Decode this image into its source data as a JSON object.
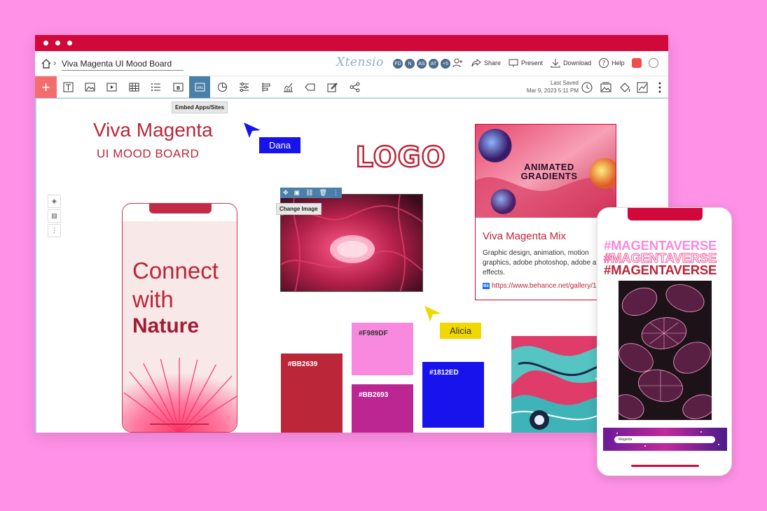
{
  "window": {
    "title_dots": 3
  },
  "topbar": {
    "board_name": "Viva Magenta UI Mood Board",
    "app_logo": "Xtensio",
    "avatars": [
      "FD",
      "N",
      "AS",
      "AT",
      "+5"
    ],
    "actions": {
      "share": "Share",
      "present": "Present",
      "download": "Download",
      "help": "Help"
    }
  },
  "toolbar": {
    "tools": [
      "text",
      "image",
      "video",
      "table",
      "list",
      "button",
      "url",
      "chart",
      "settings",
      "align",
      "graph",
      "tag",
      "edit",
      "share"
    ],
    "active_tool": "url",
    "url_label": "URL",
    "button_label": "B",
    "tooltip": "Embed Apps/Sites",
    "last_saved_label": "Last Saved",
    "last_saved_date": "Mar 9, 2023 5:11 PM"
  },
  "board": {
    "title": "Viva Magenta",
    "subtitle": "UI MOOD BOARD",
    "logo_text": "LOGO",
    "change_image_tooltip": "Change Image",
    "cursors": [
      {
        "name": "Dana",
        "color": "#1812ed"
      },
      {
        "name": "Alicia",
        "color": "#f0d800"
      }
    ],
    "phone1": {
      "line1": "Connect",
      "line2": "with",
      "line3": "Nature"
    },
    "card": {
      "banner_line1": "ANIMATED",
      "banner_line2": "GRADIENTS",
      "title": "Viva Magenta Mix",
      "description": "Graphic design, animation, motion graphics, adobe photoshop, adobe after effects.",
      "link": "https://www.behance.net/gallery/15",
      "link_badge": "Bē"
    },
    "swatches": [
      {
        "label": "#BB2639",
        "color": "#bb2639"
      },
      {
        "label": "#F989DF",
        "color": "#f989df"
      },
      {
        "label": "#BB2693",
        "color": "#bb2693"
      },
      {
        "label": "#1812ED",
        "color": "#1812ed"
      }
    ],
    "phone2": {
      "headline": "#MAGENTAVERSE",
      "search_text": "Magenta"
    }
  }
}
